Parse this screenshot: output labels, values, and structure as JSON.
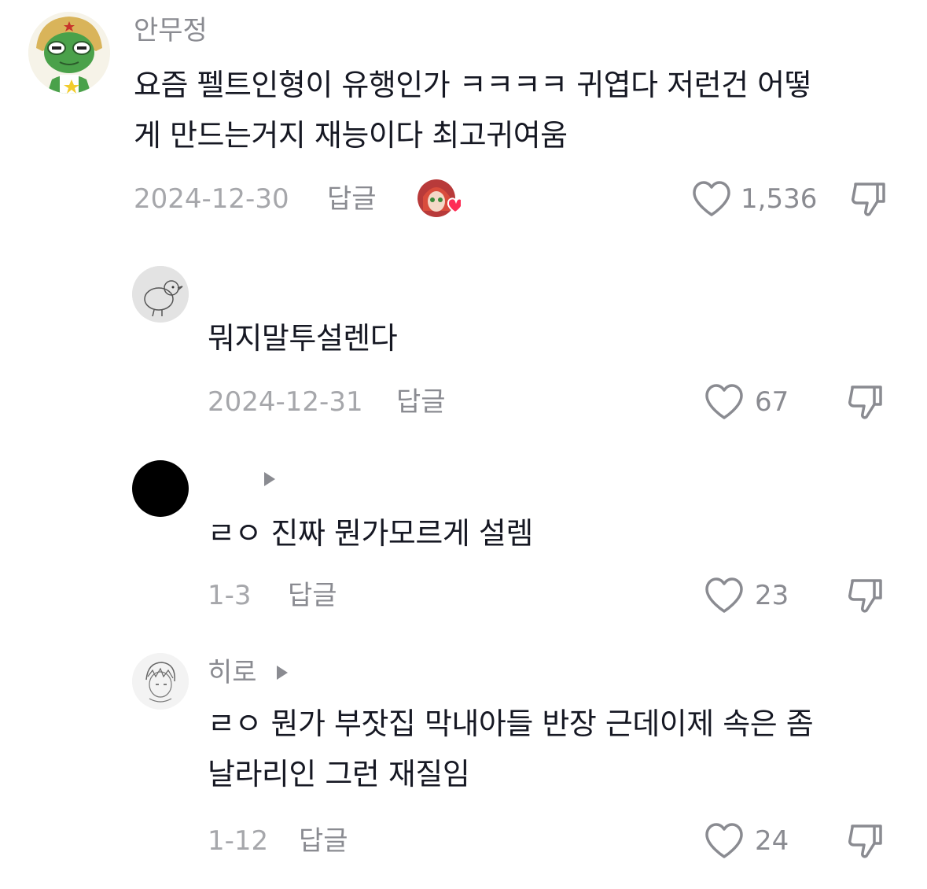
{
  "comments": [
    {
      "username": "안무정",
      "text_line1": "요즘 펠트인형이 유행인가 ㅋㅋㅋㅋ 귀엽다 저런건 어떻",
      "text_line2": "게 만드는거지 재능이다 최고귀여움",
      "date": "2024-12-30",
      "reply_label": "답글",
      "likes": "1,536",
      "avatar_icon": "frog-character-avatar",
      "liked_by_creator_icon": "creator-heart-avatar"
    },
    {
      "username": "",
      "text_line1": "뭐지말투설렌다",
      "date": "2024-12-31",
      "reply_label": "답글",
      "likes": "67",
      "avatar_icon": "bird-sketch-avatar"
    },
    {
      "username": "",
      "text_line1": "ㄹㅇ 진짜 뭔가모르게 설렘",
      "date": "1-3",
      "reply_label": "답글",
      "likes": "23",
      "avatar_icon": "black-circle-avatar"
    },
    {
      "username": "히로",
      "text_line1": "ㄹㅇ 뭔가 부잣집 막내아들 반장 근데이제 속은 좀",
      "text_line2": "날라리인 그런 재질임",
      "date": "1-12",
      "reply_label": "답글",
      "likes": "24",
      "avatar_icon": "boy-sketch-avatar"
    }
  ],
  "colors": {
    "text": "#161823",
    "secondary": "#8a8b91",
    "date": "#a6a7ab",
    "heart_badge": "#fe2c55"
  }
}
